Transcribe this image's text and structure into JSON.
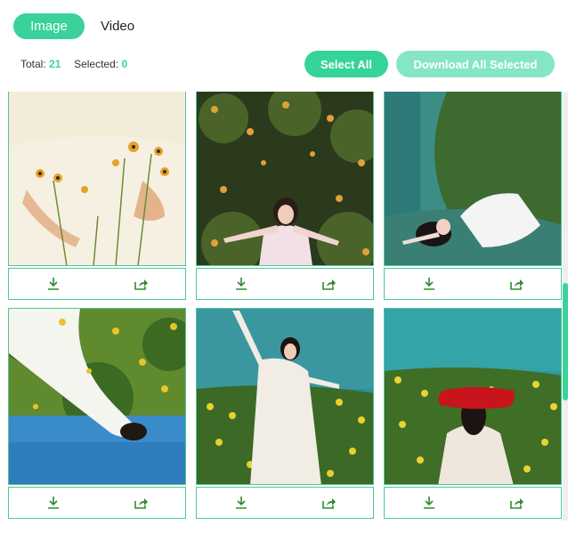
{
  "tabs": [
    {
      "label": "Image",
      "active": true
    },
    {
      "label": "Video",
      "active": false
    }
  ],
  "stats": {
    "total_label": "Total:",
    "total_value": "21",
    "selected_label": "Selected:",
    "selected_value": "0"
  },
  "buttons": {
    "select_all": "Select All",
    "download_all": "Download All Selected"
  },
  "colors": {
    "accent": "#3ad29a",
    "accent_light": "#85e6c4",
    "border": "#4cc79a",
    "icon": "#2e8b2e"
  },
  "gallery": {
    "items": [
      {
        "photo": "woman-in-white-holding-yellow-flowers",
        "download_icon": "download-icon",
        "share_icon": "share-icon"
      },
      {
        "photo": "woman-lying-in-yellow-flower-field",
        "download_icon": "download-icon",
        "share_icon": "share-icon"
      },
      {
        "photo": "woman-in-white-lying-by-stream",
        "download_icon": "download-icon",
        "share_icon": "share-icon"
      },
      {
        "photo": "upside-down-woman-in-white-dress",
        "download_icon": "download-icon",
        "share_icon": "share-icon"
      },
      {
        "photo": "woman-raising-arm-in-flower-field",
        "download_icon": "download-icon",
        "share_icon": "share-icon"
      },
      {
        "photo": "woman-with-red-cloth-over-face",
        "download_icon": "download-icon",
        "share_icon": "share-icon"
      }
    ]
  }
}
